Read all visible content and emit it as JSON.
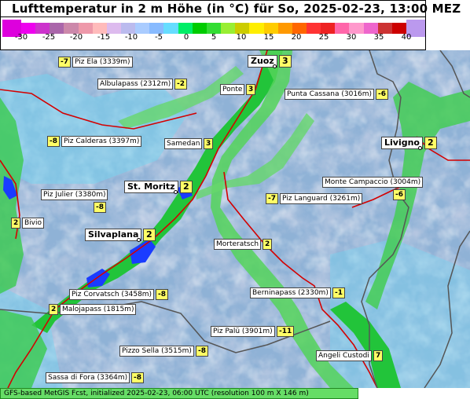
{
  "title": "Lufttemperatur in 2 m Höhe (in °C) für So, 2025-02-23, 13:00 MEZ",
  "legend": {
    "ticks": [
      "-30",
      "-25",
      "-20",
      "-15",
      "-10",
      "-5",
      "0",
      "5",
      "10",
      "15",
      "20",
      "25",
      "30",
      "35",
      "40"
    ],
    "colors": [
      "#ee00ee",
      "#cc33cc",
      "#aa66aa",
      "#cc88aa",
      "#ee99aa",
      "#ffbbbb",
      "#ddbbee",
      "#bbbbee",
      "#aaccff",
      "#88bbff",
      "#66ddff",
      "#00ee66",
      "#00cc00",
      "#33dd33",
      "#99ee33",
      "#cccc00",
      "#ffee00",
      "#ffcc00",
      "#ff9900",
      "#ff6600",
      "#ff3333",
      "#ee2222",
      "#ff66aa",
      "#ff99cc",
      "#ee66cc",
      "#cc3333",
      "#cc0000"
    ],
    "end_left_color": "#dd00dd",
    "end_right_color": "#bb99ee"
  },
  "stations": [
    {
      "name": "Piz Ela (3339m)",
      "value": "-7",
      "big": false
    },
    {
      "name": "Zuoz",
      "value": "3",
      "big": true
    },
    {
      "name": "Albulapass (2312m)",
      "value": "-2",
      "big": false
    },
    {
      "name": "Ponte",
      "value": "3",
      "big": false
    },
    {
      "name": "Punta Cassana (3016m)",
      "value": "-6",
      "big": false
    },
    {
      "name": "Piz Calderas (3397m)",
      "value": "-8",
      "big": false
    },
    {
      "name": "Samedan",
      "value": "3",
      "big": false
    },
    {
      "name": "Livigno",
      "value": "2",
      "big": true
    },
    {
      "name": "Monte Campaccio (3004m)",
      "value": "-6",
      "big": false
    },
    {
      "name": "St. Moritz",
      "value": "2",
      "big": true
    },
    {
      "name": "Piz Julier (3380m)",
      "value": "-8",
      "big": false
    },
    {
      "name": "Piz Languard (3261m)",
      "value": "-7",
      "big": false
    },
    {
      "name": "Bivio",
      "value": "2",
      "big": false
    },
    {
      "name": "Silvaplana",
      "value": "2",
      "big": true
    },
    {
      "name": "Morteratsch",
      "value": "2",
      "big": false
    },
    {
      "name": "Piz Corvatsch (3458m)",
      "value": "-8",
      "big": false
    },
    {
      "name": "Berninapass (2330m)",
      "value": "-1",
      "big": false
    },
    {
      "name": "Malojapass (1815m)",
      "value": "2",
      "big": false
    },
    {
      "name": "Piz Palü (3901m)",
      "value": "-11",
      "big": false
    },
    {
      "name": "Pizzo Sella (3515m)",
      "value": "-8",
      "big": false
    },
    {
      "name": "Angeli Custodi",
      "value": "7",
      "big": false
    },
    {
      "name": "Sassa di Fora (3364m)",
      "value": "-8",
      "big": false
    }
  ],
  "footer": "GFS-based MetGIS Fcst, initialized 2025-02-23, 06:00 UTC  (resolution 100 m X 146 m)"
}
